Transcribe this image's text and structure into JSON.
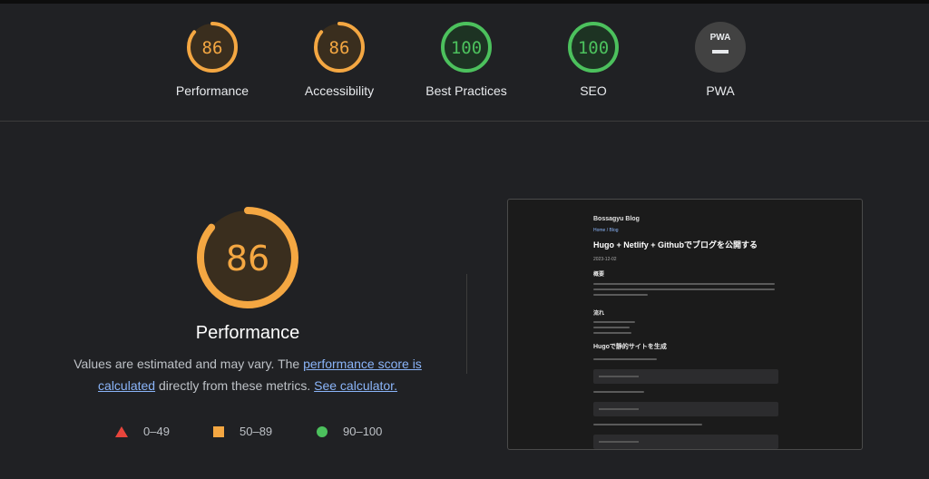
{
  "gauges": [
    {
      "value": "86",
      "score": 86,
      "label": "Performance",
      "color": "#f4a742"
    },
    {
      "value": "86",
      "score": 86,
      "label": "Accessibility",
      "color": "#f4a742"
    },
    {
      "value": "100",
      "score": 100,
      "label": "Best Practices",
      "color": "#4cc15d"
    },
    {
      "value": "100",
      "score": 100,
      "label": "SEO",
      "color": "#4cc15d"
    },
    {
      "value": "PWA",
      "label": "PWA",
      "color": "#9aa0a6"
    }
  ],
  "main": {
    "score_text": "86",
    "score": 86,
    "title": "Performance",
    "desc_prefix": "Values are estimated and may vary. The ",
    "link_score": "performance score is calculated",
    "desc_middle": " directly from these metrics. ",
    "link_calc": "See calculator."
  },
  "legend": [
    {
      "range": "0–49",
      "shape": "triangle-icon",
      "color": "#e8453c"
    },
    {
      "range": "50–89",
      "shape": "square-icon",
      "color": "#f4a742"
    },
    {
      "range": "90–100",
      "shape": "circle-icon",
      "color": "#4cc15d"
    }
  ],
  "thumbnail": {
    "site_title": "Bossagyu Blog",
    "crumbs": "Home / Blog",
    "heading": "Hugo + Netlify + Githubでブログを公開する",
    "date": "2023-12-02",
    "section1": "概要",
    "section2": "流れ",
    "section3": "Hugoで静的サイトを生成"
  },
  "colors": {
    "background": "#202124",
    "orange": "#f4a742",
    "green": "#4cc15d",
    "link": "#8ab4f8"
  }
}
